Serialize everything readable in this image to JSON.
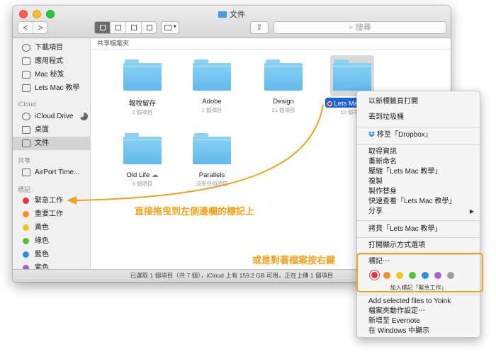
{
  "window": {
    "title": "文件",
    "search_placeholder": "搜尋",
    "path_label": "共享檔案夾",
    "status": "已選取 1 個項目（共 7 個），iCloud 上有 159.2 GB 可用，正在上傳 1 個項目"
  },
  "toolbar": {
    "back": "<",
    "forward": ">",
    "arrange_chevron": "▾",
    "share_glyph": "⇪"
  },
  "sidebar": {
    "sections": {
      "icloud": "iCloud",
      "shared": "共享",
      "tags": "標記"
    },
    "favorites": [
      {
        "label": "下載項目",
        "icon": "download-icon"
      },
      {
        "label": "應用程式",
        "icon": "applications-icon"
      },
      {
        "label": "Mac 秘笈",
        "icon": "folder-icon"
      },
      {
        "label": "Lets Mac 教學",
        "icon": "folder-icon"
      }
    ],
    "icloud_items": [
      {
        "label": "iCloud Drive",
        "icon": "cloud-icon"
      },
      {
        "label": "桌面",
        "icon": "desktop-icon"
      },
      {
        "label": "文件",
        "icon": "documents-icon",
        "selected": true
      }
    ],
    "shared_items": [
      {
        "label": "AirPort Time...",
        "icon": "airport-icon"
      }
    ],
    "tags": [
      {
        "label": "緊急工作",
        "color": "#e8343a"
      },
      {
        "label": "重要工作",
        "color": "#f5922a"
      },
      {
        "label": "黃色",
        "color": "#f2c418"
      },
      {
        "label": "綠色",
        "color": "#53c03a"
      },
      {
        "label": "藍色",
        "color": "#2f8fe3"
      },
      {
        "label": "紫色",
        "color": "#a562c9"
      }
    ]
  },
  "files": [
    {
      "name": "報稅留存",
      "sub": "2 個項目"
    },
    {
      "name": "Adobe",
      "sub": "1 個項目"
    },
    {
      "name": "Design",
      "sub": "21 個項目"
    },
    {
      "name": "Lets Mac 教學",
      "sub": "10 個項目",
      "selected": true
    },
    {
      "name": "Old Life",
      "sub": "3 個項目",
      "cloud": "☁"
    },
    {
      "name": "Parallels",
      "sub": "沒有任何項目"
    }
  ],
  "context_menu": {
    "items_a": [
      "以新標籤頁打開",
      "丟到垃圾桶"
    ],
    "dropbox": "移至「Dropbox」",
    "items_b": [
      "取得資訊",
      "重新命名",
      "壓縮「Lets Mac 教學」",
      "複製",
      "製作替身",
      "快速查看「Lets Mac 教學」",
      "分享"
    ],
    "share_arrow": "▶",
    "copy_item": "拷貝「Lets Mac 教學」",
    "view_options": "打開顯示方式選項",
    "tags_label": "標記⋯",
    "tag_colors": [
      "#e8343a",
      "#f5922a",
      "#f2c418",
      "#53c03a",
      "#2f8fe3",
      "#a562c9",
      "#9b9b9b"
    ],
    "tag_caption": "加入標記「緊急工作」",
    "items_c": [
      "Add selected files to Yoink",
      "檔案夾動作設定⋯",
      "新增至 Evernote",
      "在 Windows 中顯示"
    ]
  },
  "annotations": {
    "drag_hint": "直接拖曳到左側邊欄的標記上",
    "right_click_hint": "或是對著檔案按右鍵",
    "accent_color": "#f0a21c"
  }
}
